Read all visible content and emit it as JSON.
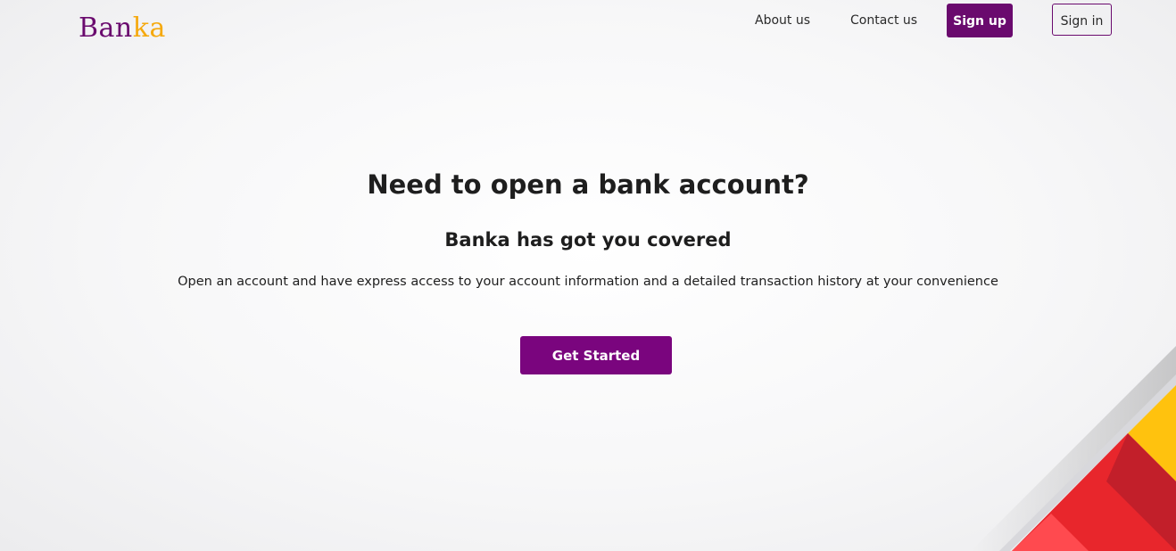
{
  "brand": {
    "logo_part1": "Ban",
    "logo_part2": "ka",
    "color_primary": "#6a0a6e",
    "color_accent": "#f5a90f"
  },
  "nav": {
    "about_label": "About us",
    "contact_label": "Contact us",
    "signup_label": "Sign up",
    "signin_label": "Sign in"
  },
  "hero": {
    "title": "Need to open a bank account?",
    "subtitle": "Banka has got you covered",
    "description": "Open an account and have express access to your account information and a detailed transaction history at your convenience",
    "cta_label": "Get Started",
    "cta_color": "#7a057e"
  },
  "decoration": {
    "stripe_colors": [
      "#ffc20e",
      "#e8262c",
      "#c21f2a",
      "#ff4a4f"
    ]
  }
}
